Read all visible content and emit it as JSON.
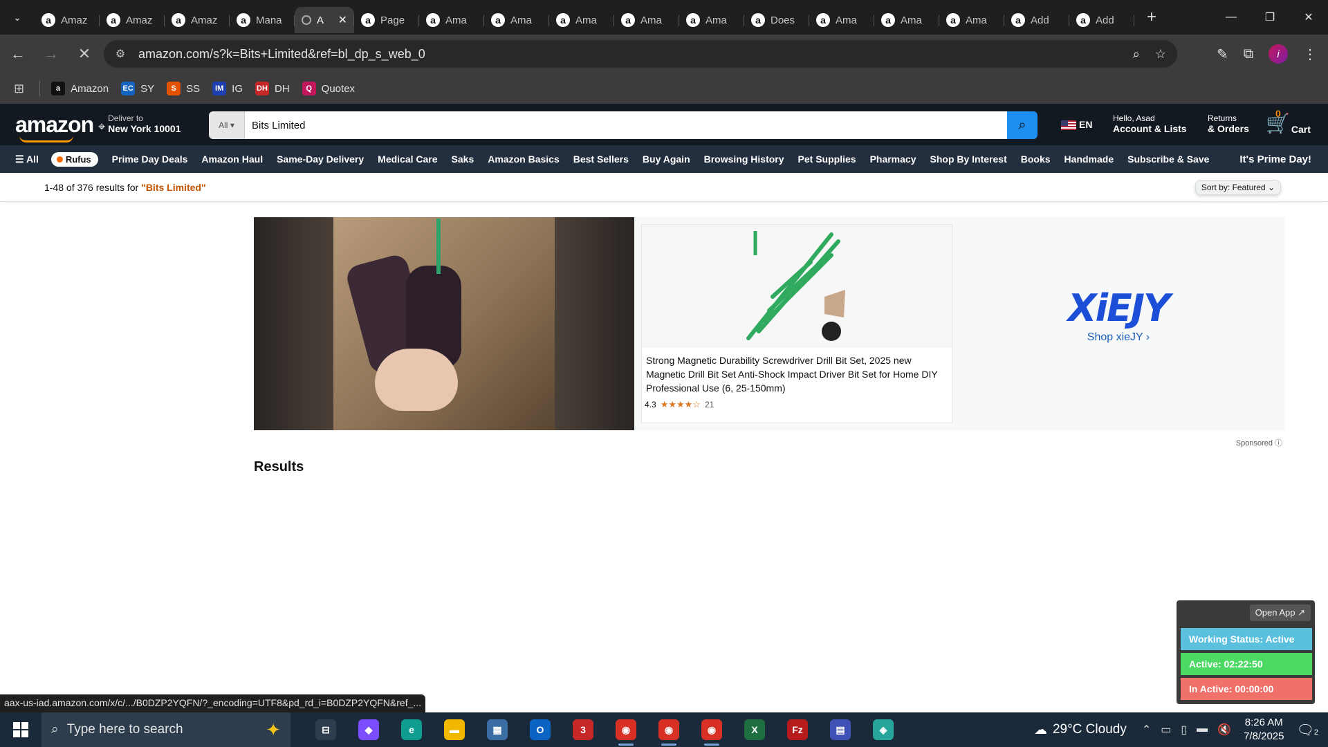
{
  "browser": {
    "tabs": [
      {
        "title": "Amaz",
        "icon": "amazon"
      },
      {
        "title": "Amaz",
        "icon": "amazon"
      },
      {
        "title": "Amaz",
        "icon": "amazon"
      },
      {
        "title": "Mana",
        "icon": "amazon"
      },
      {
        "title": "A",
        "icon": "loading",
        "active": true
      },
      {
        "title": "Page",
        "icon": "amazon"
      },
      {
        "title": "Ama",
        "icon": "amazon"
      },
      {
        "title": "Ama",
        "icon": "amazon"
      },
      {
        "title": "Ama",
        "icon": "amazon"
      },
      {
        "title": "Ama",
        "icon": "amazon"
      },
      {
        "title": "Ama",
        "icon": "amazon"
      },
      {
        "title": "Does",
        "icon": "amazon"
      },
      {
        "title": "Ama",
        "icon": "amazon"
      },
      {
        "title": "Ama",
        "icon": "amazon"
      },
      {
        "title": "Ama",
        "icon": "amazon"
      },
      {
        "title": "Add",
        "icon": "amazon"
      },
      {
        "title": "Add",
        "icon": "amazon"
      }
    ],
    "url": "amazon.com/s?k=Bits+Limited&ref=bl_dp_s_web_0",
    "profile_initial": "i",
    "bookmarks": [
      {
        "label": "Amazon",
        "color": "#111111",
        "glyph": "a"
      },
      {
        "label": "SY",
        "color": "#1565c0",
        "glyph": "EC"
      },
      {
        "label": "SS",
        "color": "#e65100",
        "glyph": "S"
      },
      {
        "label": "IG",
        "color": "#1e40af",
        "glyph": "IM"
      },
      {
        "label": "DH",
        "color": "#c62828",
        "glyph": "DH"
      },
      {
        "label": "Quotex",
        "color": "#c2185b",
        "glyph": "Q"
      }
    ],
    "status_url": "aax-us-iad.amazon.com/x/c/.../B0DZP2YQFN/?_encoding=UTF8&pd_rd_i=B0DZP2YQFN&ref_..."
  },
  "amazon": {
    "logo": "amazon",
    "deliver_line1": "Deliver to",
    "deliver_line2": "New York 10001",
    "search_category": "All",
    "search_value": "Bits Limited",
    "language": "EN",
    "account_line1": "Hello, Asad",
    "account_line2": "Account & Lists",
    "returns_line1": "Returns",
    "returns_line2": "& Orders",
    "cart_count": "0",
    "cart_label": "Cart",
    "nav_all": "All",
    "nav_rufus": "Rufus",
    "nav_items": [
      "Prime Day Deals",
      "Amazon Haul",
      "Same-Day Delivery",
      "Medical Care",
      "Saks",
      "Amazon Basics",
      "Best Sellers",
      "Buy Again",
      "Browsing History",
      "Pet Supplies",
      "Pharmacy",
      "Shop By Interest",
      "Books",
      "Handmade",
      "Subscribe & Save"
    ],
    "prime_day": "It's Prime Day!",
    "results_count": "1-48 of 376 results for",
    "results_query": "\"Bits Limited\"",
    "sort_label": "Sort by:",
    "sort_value": "Featured",
    "sponsored_product": {
      "title": "Strong Magnetic Durability Screwdriver Drill Bit Set, 2025 new Magnetic Drill Bit Set Anti-Shock Impact Driver Bit Set for Home DIY Professional Use (6, 25-150mm)",
      "rating": "4.3",
      "stars": "★★★★☆",
      "reviews": "21"
    },
    "brand_logo": "XiEJY",
    "brand_link": "Shop xieJY ›",
    "sponsored_label": "Sponsored ⓘ",
    "results_heading": "Results"
  },
  "widget": {
    "open_app": "Open App ↗",
    "working_status": "Working Status: Active",
    "active": "Active: 02:22:50",
    "inactive": "In Active: 00:00:00",
    "colors": {
      "working": "#5bc0de",
      "active": "#4cd964",
      "inactive": "#f0706a"
    }
  },
  "taskbar": {
    "search_placeholder": "Type here to search",
    "weather": "29°C  Cloudy",
    "time": "8:26 AM",
    "date": "7/8/2025",
    "notification_count": "2",
    "apps": [
      {
        "name": "task-view",
        "color": "#2d3d4e",
        "glyph": "⊟"
      },
      {
        "name": "copilot",
        "color": "#7c4dff",
        "glyph": "◆"
      },
      {
        "name": "edge",
        "color": "#0f9d8f",
        "glyph": "e"
      },
      {
        "name": "file-explorer",
        "color": "#f2b800",
        "glyph": "▬"
      },
      {
        "name": "store",
        "color": "#3a6ea5",
        "glyph": "▦"
      },
      {
        "name": "outlook",
        "color": "#0b63c4",
        "glyph": "O"
      },
      {
        "name": "teams",
        "color": "#c62828",
        "glyph": "3"
      },
      {
        "name": "chrome-1",
        "color": "#d93025",
        "glyph": "◉"
      },
      {
        "name": "chrome-2",
        "color": "#d93025",
        "glyph": "◉"
      },
      {
        "name": "chrome-3",
        "color": "#d93025",
        "glyph": "◉"
      },
      {
        "name": "excel",
        "color": "#1d6f42",
        "glyph": "X"
      },
      {
        "name": "filezilla",
        "color": "#b71c1c",
        "glyph": "Fz"
      },
      {
        "name": "calculator",
        "color": "#3f51b5",
        "glyph": "▤"
      },
      {
        "name": "app",
        "color": "#26a69a",
        "glyph": "◈"
      }
    ]
  }
}
